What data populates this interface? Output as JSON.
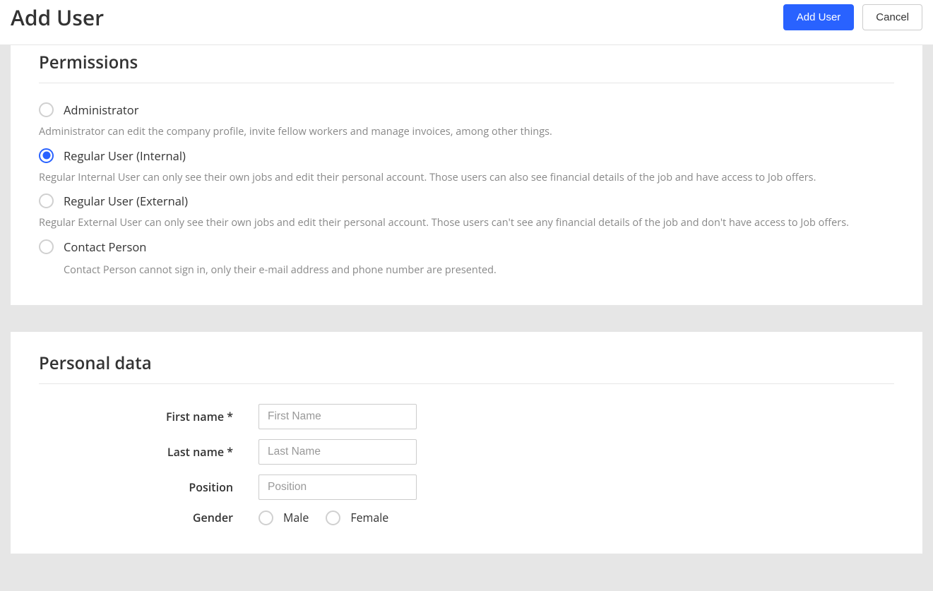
{
  "header": {
    "title": "Add User",
    "add_user_label": "Add User",
    "cancel_label": "Cancel"
  },
  "permissions": {
    "section_title": "Permissions",
    "options": [
      {
        "label": "Administrator",
        "description": "Administrator can edit the company profile, invite fellow workers and manage invoices, among other things."
      },
      {
        "label": "Regular User (Internal)",
        "description": "Regular Internal User can only see their own jobs and edit their personal account. Those users can also see financial details of the job and have access to Job offers."
      },
      {
        "label": "Regular User (External)",
        "description": "Regular External User can only see their own jobs and edit their personal account. Those users can't see any financial details of the job and don't have access to Job offers."
      },
      {
        "label": "Contact Person",
        "description": "Contact Person cannot sign in, only their e-mail address and phone number are presented."
      }
    ],
    "selected_index": 1
  },
  "personal_data": {
    "section_title": "Personal data",
    "first_name_label": "First name *",
    "first_name_placeholder": "First Name",
    "last_name_label": "Last name *",
    "last_name_placeholder": "Last Name",
    "position_label": "Position",
    "position_placeholder": "Position",
    "gender_label": "Gender",
    "gender_options": [
      "Male",
      "Female"
    ]
  }
}
